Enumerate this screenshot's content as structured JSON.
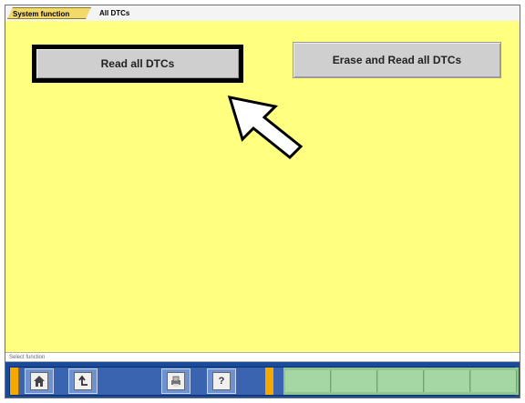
{
  "tabs": [
    {
      "label": "System function"
    },
    {
      "label": "All DTCs"
    }
  ],
  "buttons": {
    "read_all": "Read all DTCs",
    "erase_read_all": "Erase and Read all DTCs"
  },
  "status_text": "Select function",
  "toolbar": {
    "help_label": "?"
  },
  "colors": {
    "main_background": "#ffff80",
    "bottom_bar": "#1a4a9a",
    "accent_orange": "#f5a800",
    "slot_green": "#a5d7a5"
  }
}
